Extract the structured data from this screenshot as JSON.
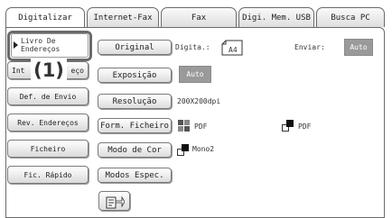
{
  "tabs": [
    "Digitalizar",
    "Internet-Fax",
    "Fax",
    "Digi. Mem. USB",
    "Busca PC"
  ],
  "sidebar": {
    "items": [
      "Livro De Endereços",
      "Int Endereço",
      "Def. de Envio",
      "Rev. Endereços",
      "Ficheiro",
      "Fic. Rápido"
    ],
    "item0_line1": "Livro De",
    "item0_line2": "Endereços",
    "item1_left": "Int",
    "item1_right": "eço",
    "callout": "(1)"
  },
  "settings": {
    "original_label": "Original",
    "digita_label": "Digita.:",
    "paper_size": "A4",
    "enviar_label": "Enviar:",
    "enviar_value": "Auto",
    "exposicao_label": "Exposição",
    "exposicao_value": "Auto",
    "resolucao_label": "Resolução",
    "resolucao_value": "200X200dpi",
    "form_ficheiro_label": "Form. Ficheiro",
    "format_color": "PDF",
    "format_mono": "PDF",
    "modo_cor_label": "Modo de Cor",
    "modo_cor_value": "Mono2",
    "modos_espec_label": "Modos Espec."
  }
}
